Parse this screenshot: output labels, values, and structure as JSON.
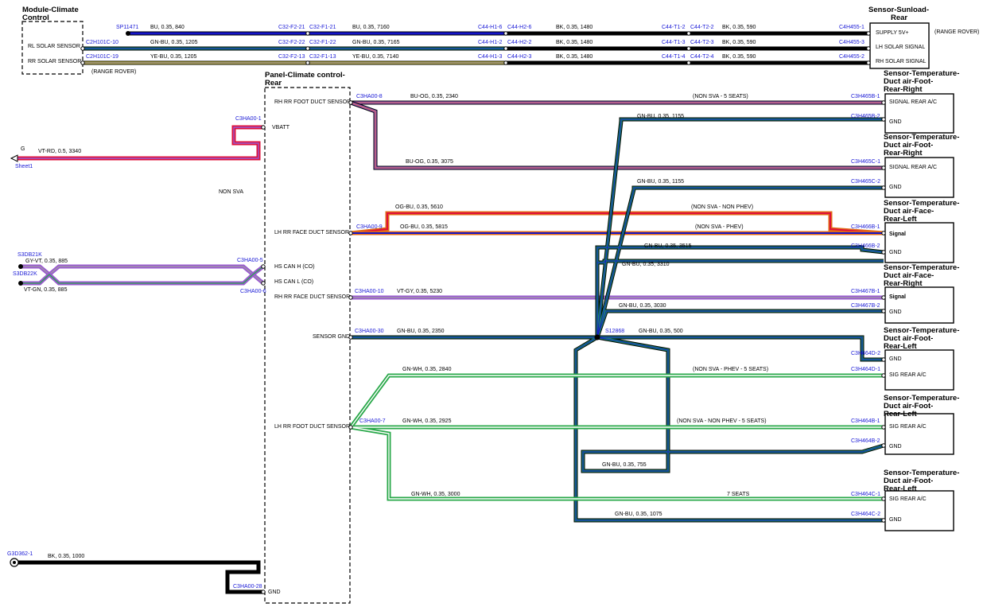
{
  "components": {
    "module_climate": {
      "title_1": "Module-Climate",
      "title_2": "Control",
      "pins": [
        "RL SOLAR SENSOR",
        "RR SOLAR SENSOR"
      ]
    },
    "sunload": {
      "title_1": "Sensor-Sunload-",
      "title_2": "Rear",
      "pins": [
        "SUPPLY 5V+",
        "LH SOLAR SIGNAL",
        "RH SOLAR SIGNAL"
      ],
      "note": "(RANGE ROVER)"
    },
    "panel": {
      "title_1": "Panel-Climate control-",
      "title_2": "Rear",
      "pins": [
        "RH RR FOOT DUCT SENSOR",
        "VBATT",
        "LH RR FACE DUCT SENSOR",
        "HS CAN H (CO)",
        "HS CAN L (CO)",
        "RH RR FACE DUCT SENSOR",
        "SENSOR GND",
        "LH RR FOOT DUCT SENSOR",
        "GND"
      ]
    },
    "s465b": {
      "title": [
        "Sensor-Temperature-",
        "Duct air-Foot-",
        "Rear-Right"
      ],
      "pins": [
        "SIGNAL REAR A/C",
        "GND"
      ]
    },
    "s465c": {
      "title": [
        "Sensor-Temperature-",
        "Duct air-Foot-",
        "Rear-Right"
      ],
      "pins": [
        "SIGNAL REAR A/C",
        "GND"
      ]
    },
    "s466b": {
      "title": [
        "Sensor-Temperature-",
        "Duct air-Face-",
        "Rear-Left"
      ],
      "pins": [
        "Signal",
        "GND"
      ]
    },
    "s467b": {
      "title": [
        "Sensor-Temperature-",
        "Duct air-Face-",
        "Rear-Right"
      ],
      "pins": [
        "Signal",
        "GND"
      ]
    },
    "s464d": {
      "title": [
        "Sensor-Temperature-",
        "Duct air-Foot-",
        "Rear-Left"
      ],
      "pins": [
        "GND",
        "SIG REAR A/C"
      ]
    },
    "s464b": {
      "title": [
        "Sensor-Temperature-",
        "Duct air-Foot-",
        "Rear-Left"
      ],
      "pins": [
        "SIG REAR A/C",
        "GND"
      ]
    },
    "s464c": {
      "title": [
        "Sensor-Temperature-",
        "Duct air-Foot-",
        "Rear-Left"
      ],
      "pins": [
        "SIG REAR A/C",
        "GND"
      ]
    }
  },
  "connectors": {
    "sp11471": "SP11471",
    "c2h101c_10": "C2H101C-10",
    "c2h101c_19": "C2H101C-19",
    "c32f2_21": "C32-F2-21",
    "c32f1_21": "C32-F1-21",
    "c32f2_22": "C32-F2-22",
    "c32f1_22": "C32-F1-22",
    "c32f2_13": "C32-F2-13",
    "c32f1_13": "C32-F1-13",
    "c44h1_6": "C44-H1-6",
    "c44h2_6": "C44-H2-6",
    "c44h1_2": "C44-H1-2",
    "c44h2_2": "C44-H2-2",
    "c44h1_3": "C44-H1-3",
    "c44h2_3": "C44-H2-3",
    "c44t1_2": "C44-T1-2",
    "c44t2_2": "C44-T2-2",
    "c44t1_3": "C44-T1-3",
    "c44t2_3": "C44-T2-3",
    "c44t1_4": "C44-T1-4",
    "c44t2_4": "C44-T2-4",
    "c4h455_1": "C4H455-1",
    "c4h455_3": "C4H455-3",
    "c4h455_2": "C4H455-2",
    "c3ha00_8": "C3HA00-8",
    "c3ha00_1": "C3HA00-1",
    "c3ha00_9": "C3HA00-9",
    "c3ha00_5": "C3HA00-5",
    "c3ha00_6": "C3HA00-6",
    "c3ha00_10": "C3HA00-10",
    "c3ha00_30": "C3HA00-30",
    "c3ha00_7": "C3HA00-7",
    "c3ha00_28": "C3HA00-28",
    "c3h465b_1": "C3H465B-1",
    "c3h465b_2": "C3H465B-2",
    "c3h465c_1": "C3H465C-1",
    "c3h465c_2": "C3H465C-2",
    "c3h466b_1": "C3H466B-1",
    "c3h466b_2": "C3H466B-2",
    "c3h467b_1": "C3H467B-1",
    "c3h467b_2": "C3H467B-2",
    "c3h464d_2": "C3H464D-2",
    "c3h464d_1": "C3H464D-1",
    "c3h464b_1": "C3H464B-1",
    "c3h464b_2": "C3H464B-2",
    "c3h464c_1": "C3H464C-1",
    "c3h464c_2": "C3H464C-2",
    "s12868": "S12868",
    "s3db21k": "S3DB21K",
    "s3db22k": "S3DB22K",
    "g3d362_1": "G3D362-1",
    "sheet": "Sheet1",
    "ground_g": "G"
  },
  "wires": {
    "w840": "BU,  0.35,  840",
    "w7160": "BU,  0.35,  7160",
    "w1205a": "GN-BU,  0.35,  1205",
    "w7165": "GN-BU,  0.35,  7165",
    "w1205b": "YE-BU,  0.35,  1205",
    "w7140": "YE-BU,  0.35,  7140",
    "w1480": "BK,  0.35,  1480",
    "w590": "BK,  0.35,  590",
    "w2340": "BU-OG,  0.35,  2340",
    "w3075": "BU-OG,  0.35,  3075",
    "w3340": "VT-RD,  0.5,  3340",
    "w1155": "GN-BU,  0.35,  1155",
    "w5610": "OG-BU,  0.35,  5610",
    "w5815": "OG-BU,  0.35,  5815",
    "w3515": "GN-BU,  0.35,  3515",
    "w3310": "GN-BU,  0.35,  3310",
    "w885a": "GY-VT,  0.35,  885",
    "w885b": "VT-GN,  0.35,  885",
    "w5230": "VT-GY,  0.35,  5230",
    "w3030": "GN-BU,  0.35,  3030",
    "w2350": "GN-BU,  0.35,  2350",
    "w500": "GN-BU,  0.35,  500",
    "w2840": "GN-WH,  0.35,  2840",
    "w2925": "GN-WH,  0.35,  2925",
    "w755": "GN-BU,  0.35,  755",
    "w3000": "GN-WH,  0.35,  3000",
    "w1075": "GN-BU,  0.35,  1075",
    "w1000": "BK,  0.35,  1000"
  },
  "notes": {
    "range_rover": "(RANGE ROVER)",
    "non_sva": "NON SVA",
    "non_sva_5": "(NON SVA - 5 SEATS)",
    "non_sva_non_phev": "(NON SVA - NON PHEV)",
    "non_sva_phev": "(NON SVA - PHEV)",
    "non_sva_phev_5": "(NON SVA - PHEV - 5 SEATS)",
    "non_sva_non_phev_5": "(NON SVA - NON PHEV - 5 SEATS)",
    "seats7": "7 SEATS"
  },
  "colors": {
    "black": "#000000",
    "blue": "#1515c8",
    "gn_bu": "#1a8a6a",
    "ye": "#f0e040",
    "vt": "#9a5ad0",
    "og": "#e06a18",
    "rd": "#e0103a",
    "gy": "#a0a0a0",
    "gn_wh": "#2aa84a",
    "label_blue": "#1a1ad6"
  }
}
